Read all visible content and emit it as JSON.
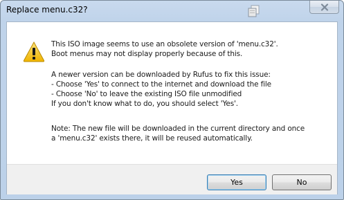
{
  "window": {
    "title": "Replace menu.c32?"
  },
  "icons": {
    "title_icon": "copy-windows-icon",
    "close": "close-icon",
    "message": "warning-icon"
  },
  "message": {
    "lines_1": [
      "This ISO image seems to use an obsolete version of 'menu.c32'.",
      "Boot menus may not display properly because of this."
    ],
    "lines_2": [
      "A newer version can be downloaded by Rufus to fix this issue:",
      "- Choose 'Yes' to connect to the internet and download the file",
      "- Choose 'No' to leave the existing ISO file unmodified",
      "If you don't know what to do, you should select 'Yes'."
    ],
    "lines_3": [
      "Note: The new file will be downloaded in the current directory and once",
      "a 'menu.c32' exists there, it will be reused automatically."
    ]
  },
  "buttons": {
    "yes_label": "Yes",
    "no_label": "No"
  },
  "colors": {
    "frame": "#bfd3ea",
    "warning_fill": "#f7c51a",
    "default_button_border": "#3c7fb1"
  }
}
